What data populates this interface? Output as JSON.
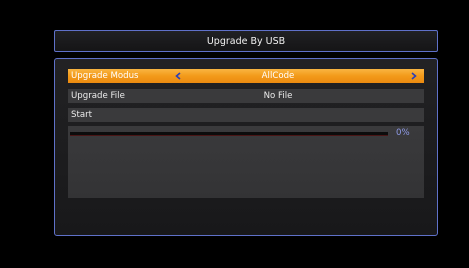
{
  "window": {
    "title": "Upgrade By USB"
  },
  "menu": {
    "upgrade_modus": {
      "label": "Upgrade Modus",
      "value": "AllCode",
      "left_arrow_icon": "arrow-left-icon",
      "right_arrow_icon": "arrow-right-icon"
    },
    "upgrade_file": {
      "label": "Upgrade File",
      "value": "No File"
    },
    "start": {
      "label": "Start"
    }
  },
  "progress": {
    "value": 0,
    "text": "0%"
  },
  "colors": {
    "selected_row": "#f39a1a",
    "frame_border": "#5f71c9",
    "progress_text": "#8f9be8",
    "progress_fill": "#c8302c"
  }
}
